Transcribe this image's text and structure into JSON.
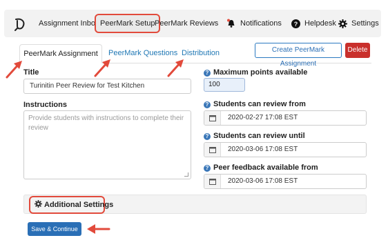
{
  "topnav": {
    "items": [
      {
        "label": "Assignment Inbox"
      },
      {
        "label": "PeerMark Setup"
      },
      {
        "label": "PeerMark Reviews"
      },
      {
        "label": "Notifications"
      },
      {
        "label": "Helpdesk"
      },
      {
        "label": "Settings"
      }
    ]
  },
  "tabs": [
    {
      "label": "PeerMark Assignment",
      "active": true
    },
    {
      "label": "PeerMark Questions",
      "active": false
    },
    {
      "label": "Distribution",
      "active": false
    }
  ],
  "actions": {
    "create_label": "Create PeerMark Assignment",
    "delete_label": "Delete"
  },
  "form": {
    "title_label": "Title",
    "title_value": "Turinitin Peer Review for Test Kitchen",
    "instructions_label": "Instructions",
    "instructions_placeholder": "Provide students with instructions to complete their review",
    "max_points_label": "Maximum points available",
    "max_points_value": "100",
    "review_from_label": "Students can review from",
    "review_from_value": "2020-02-27 17:08 EST",
    "review_until_label": "Students can review until",
    "review_until_value": "2020-03-06 17:08 EST",
    "feedback_from_label": "Peer feedback available from",
    "feedback_from_value": "2020-03-06 17:08 EST",
    "additional_settings_label": "Additional Settings",
    "save_label": "Save & Continue"
  },
  "colors": {
    "accent": "#2a6fb6",
    "highlight": "#e24a3b",
    "danger": "#c9302c"
  }
}
